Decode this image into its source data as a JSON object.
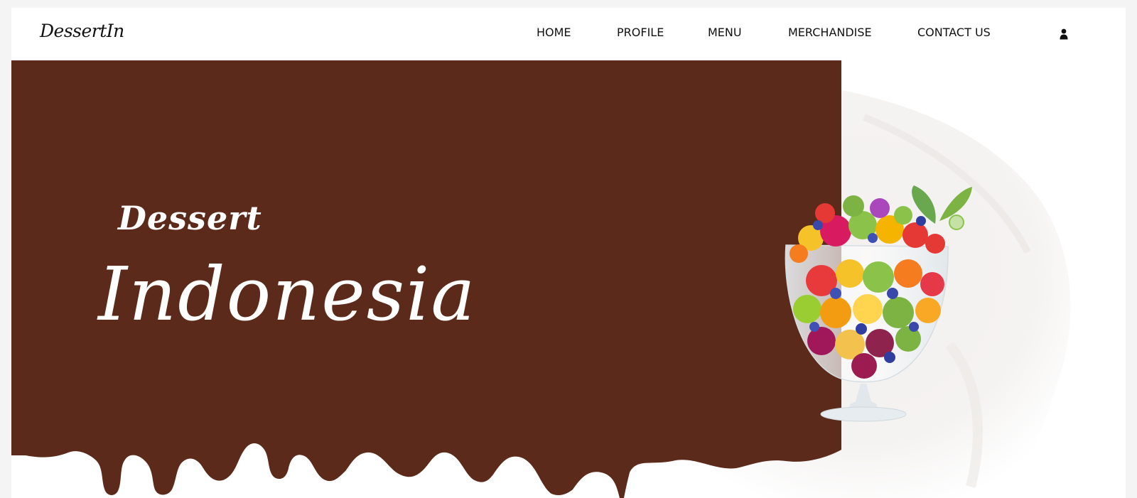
{
  "brand": {
    "logo": "DessertIn"
  },
  "nav": {
    "items": [
      {
        "label": "HOME"
      },
      {
        "label": "PROFILE"
      },
      {
        "label": "MENU"
      },
      {
        "label": "MERCHANDISE"
      },
      {
        "label": "CONTACT US"
      }
    ],
    "user_icon": "user-icon"
  },
  "hero": {
    "subtitle": "Dessert",
    "title": "Indonesia",
    "image": "fruit-salad-glass-bowl"
  },
  "colors": {
    "chocolate": "#5b2a1a",
    "background": "#ffffff",
    "text": "#111111"
  }
}
